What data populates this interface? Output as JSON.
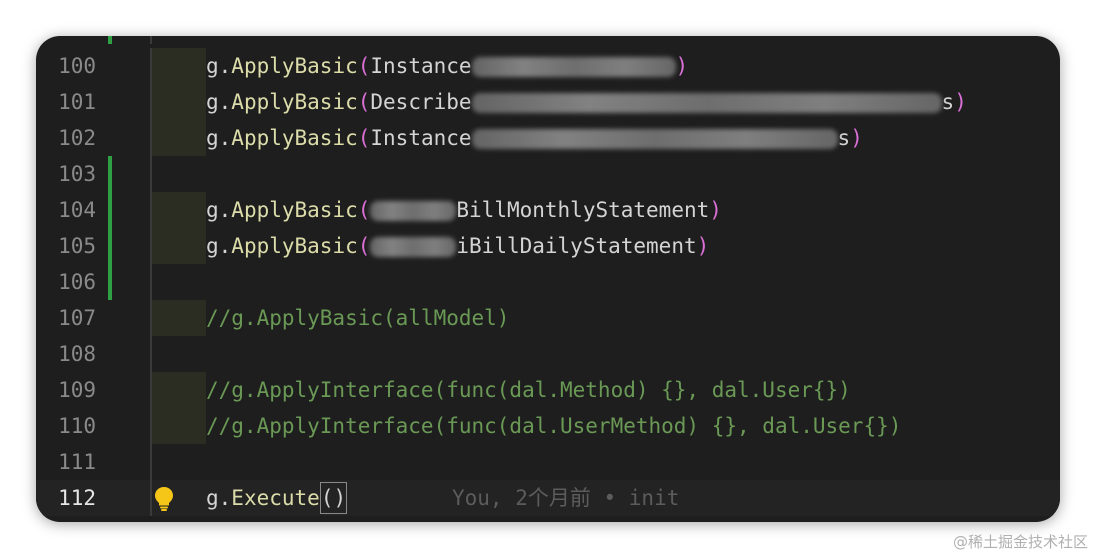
{
  "lines": [
    {
      "number": "100",
      "prefix": "g.",
      "fn": "ApplyBasic",
      "open": "(",
      "arg_before": "Instance",
      "arg_after": "",
      "close": ")"
    },
    {
      "number": "101",
      "prefix": "g.",
      "fn": "ApplyBasic",
      "open": "(",
      "arg_before": "Describe",
      "arg_after": "s",
      "close": ")"
    },
    {
      "number": "102",
      "prefix": "g.",
      "fn": "ApplyBasic",
      "open": "(",
      "arg_before": "Instance",
      "arg_after": "s",
      "close": ")"
    },
    {
      "number": "103"
    },
    {
      "number": "104",
      "prefix": "g.",
      "fn": "ApplyBasic",
      "open": "(",
      "arg_before": "",
      "arg_after": "BillMonthlyStatement",
      "close": ")"
    },
    {
      "number": "105",
      "prefix": "g.",
      "fn": "ApplyBasic",
      "open": "(",
      "arg_before": "",
      "arg_after": "iBillDailyStatement",
      "close": ")"
    },
    {
      "number": "106"
    },
    {
      "number": "107",
      "comment": "//g.ApplyBasic(allModel)"
    },
    {
      "number": "108"
    },
    {
      "number": "109",
      "comment": "//g.ApplyInterface(func(dal.Method) {}, dal.User{})"
    },
    {
      "number": "110",
      "comment": "//g.ApplyInterface(func(dal.UserMethod) {}, dal.User{})"
    },
    {
      "number": "111"
    },
    {
      "number": "112",
      "prefix": "g.",
      "fn": "Execute",
      "parens": "()"
    }
  ],
  "blame": "You, 2个月前 • init",
  "watermark": "@稀土掘金技术社区",
  "icons": [
    "lightbulb-icon"
  ],
  "colors": {
    "background": "#1e1e1e",
    "function": "#dcdcaa",
    "paren": "#da70d6",
    "comment": "#6a9955",
    "git_added": "#2ea043"
  }
}
